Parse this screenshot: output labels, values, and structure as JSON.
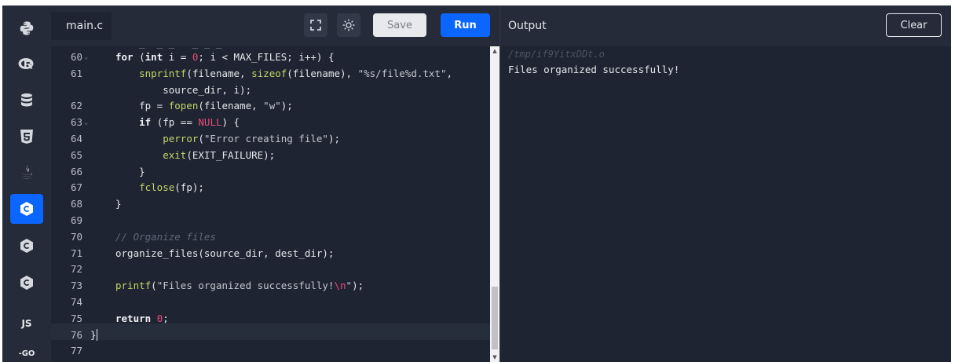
{
  "sidebar": {
    "items": [
      {
        "icon": "python-icon"
      },
      {
        "icon": "r-icon"
      },
      {
        "icon": "sql-icon"
      },
      {
        "icon": "html5-icon"
      },
      {
        "icon": "java-icon"
      },
      {
        "icon": "c-icon",
        "active": true
      },
      {
        "icon": "cpp-icon"
      },
      {
        "icon": "csharp-icon"
      },
      {
        "icon": "js-icon",
        "label": "JS"
      },
      {
        "icon": "go-icon",
        "label": "-GO"
      }
    ]
  },
  "editor": {
    "file_tab": "main.c",
    "save_label": "Save",
    "run_label": "Run",
    "lines": [
      {
        "num": "60",
        "fold": true,
        "tokens": [
          [
            "for",
            "kw"
          ],
          [
            " (",
            ""
          ],
          [
            "int",
            "kw"
          ],
          [
            " i = ",
            ""
          ],
          [
            "0",
            "num"
          ],
          [
            "; i < MAX_FILES; i++) {",
            ""
          ]
        ]
      },
      {
        "num": "61",
        "tokens": [
          [
            "    ",
            ""
          ],
          [
            "snprintf",
            "fn"
          ],
          [
            "(filename, ",
            ""
          ],
          [
            "sizeof",
            "fn"
          ],
          [
            "(filename), ",
            ""
          ],
          [
            "\"%s/file%d.txt\"",
            "str"
          ],
          [
            ",",
            ""
          ]
        ]
      },
      {
        "num": "",
        "tokens": [
          [
            "        source_dir, i);",
            ""
          ]
        ]
      },
      {
        "num": "62",
        "tokens": [
          [
            "    fp = ",
            ""
          ],
          [
            "fopen",
            "fn"
          ],
          [
            "(filename, ",
            ""
          ],
          [
            "\"w\"",
            "str"
          ],
          [
            ");",
            ""
          ]
        ]
      },
      {
        "num": "63",
        "fold": true,
        "tokens": [
          [
            "    ",
            ""
          ],
          [
            "if",
            "kw"
          ],
          [
            " (fp == ",
            ""
          ],
          [
            "NULL",
            "num"
          ],
          [
            ") {",
            ""
          ]
        ]
      },
      {
        "num": "64",
        "tokens": [
          [
            "        ",
            ""
          ],
          [
            "perror",
            "fn"
          ],
          [
            "(",
            ""
          ],
          [
            "\"Error creating file\"",
            "str"
          ],
          [
            ");",
            ""
          ]
        ]
      },
      {
        "num": "65",
        "tokens": [
          [
            "        ",
            ""
          ],
          [
            "exit",
            "fn"
          ],
          [
            "(EXIT_FAILURE);",
            ""
          ]
        ]
      },
      {
        "num": "66",
        "tokens": [
          [
            "    }",
            ""
          ]
        ]
      },
      {
        "num": "67",
        "tokens": [
          [
            "    ",
            ""
          ],
          [
            "fclose",
            "fn"
          ],
          [
            "(fp);",
            ""
          ]
        ]
      },
      {
        "num": "68",
        "tokens": [
          [
            "}",
            ""
          ]
        ]
      },
      {
        "num": "69",
        "tokens": []
      },
      {
        "num": "70",
        "tokens": [
          [
            "// Organize files",
            "cm"
          ]
        ]
      },
      {
        "num": "71",
        "tokens": [
          [
            "organize_files(source_dir, dest_dir);",
            ""
          ]
        ]
      },
      {
        "num": "72",
        "tokens": []
      },
      {
        "num": "73",
        "tokens": [
          [
            "printf",
            "fn"
          ],
          [
            "(",
            ""
          ],
          [
            "\"Files organized successfully!",
            "str"
          ],
          [
            "\\n",
            "str-esc"
          ],
          [
            "\"",
            "str"
          ],
          [
            ");",
            ""
          ]
        ]
      },
      {
        "num": "74",
        "tokens": []
      },
      {
        "num": "75",
        "tokens": [
          [
            "return",
            "kw"
          ],
          [
            " ",
            ""
          ],
          [
            "0",
            "num"
          ],
          [
            ";",
            ""
          ]
        ]
      },
      {
        "num": "76",
        "cursor": true,
        "tokens": [
          [
            "}",
            ""
          ]
        ]
      },
      {
        "num": "77",
        "tokens": []
      }
    ]
  },
  "output": {
    "title": "Output",
    "clear_label": "Clear",
    "path": "/tmp/if9YitxDDt.o",
    "text": "Files organized successfully!"
  },
  "colors": {
    "accent": "#0a66ff",
    "background": "#1e2431",
    "panel": "#252b39"
  }
}
